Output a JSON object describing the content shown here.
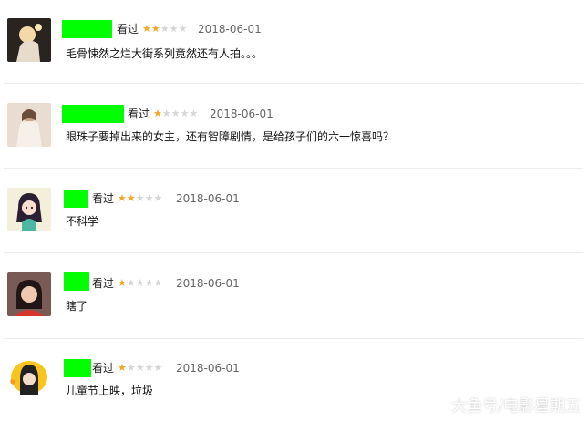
{
  "reviews": [
    {
      "watched": "看过",
      "rating": 2,
      "date": "2018-06-01",
      "comment": "毛骨悚然之烂大街系列竟然还有人拍。。。"
    },
    {
      "watched": "看过",
      "rating": 1,
      "date": "2018-06-01",
      "comment": "眼珠子要掉出来的女主，还有智障剧情，是给孩子们的六一惊喜吗？"
    },
    {
      "watched": "看过",
      "rating": 2,
      "date": "2018-06-01",
      "comment": "不科学"
    },
    {
      "watched": "看过",
      "rating": 1,
      "date": "2018-06-01",
      "comment": "瞎了"
    },
    {
      "watched": "看过",
      "rating": 1,
      "date": "2018-06-01",
      "comment": "儿童节上映，垃圾"
    }
  ],
  "star_glyph": "★",
  "colors": {
    "star_on": "#f5a623",
    "star_off": "#d6d6d6",
    "redaction": "#00ff00"
  },
  "watermark": "大鱼号/电影星期五"
}
